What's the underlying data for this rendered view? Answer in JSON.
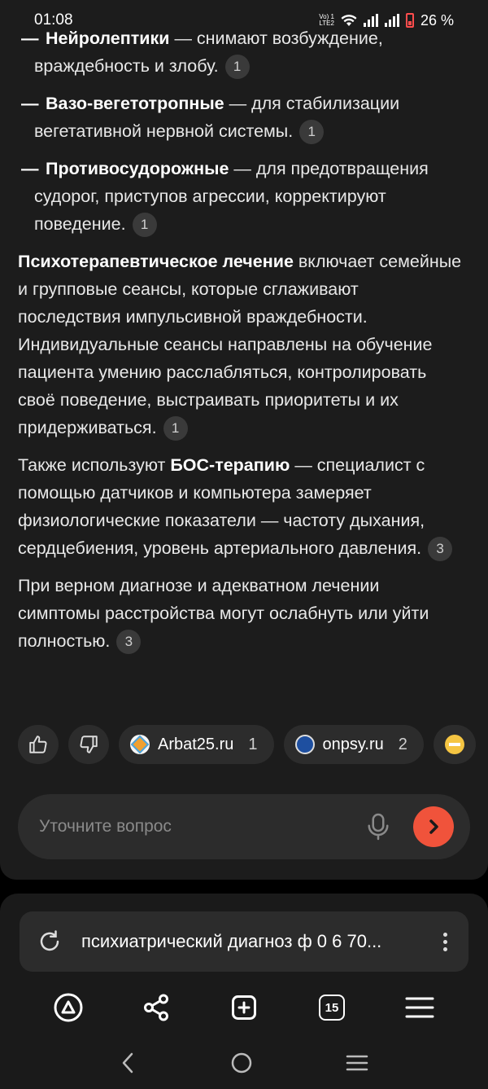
{
  "status_bar": {
    "time": "01:08",
    "network_label_top": "Vo) 1",
    "network_label_bottom": "LTE2",
    "battery": "26 %"
  },
  "answer": {
    "bullets": [
      {
        "term": "Нейролептики",
        "text": " — снимают возбуждение, враждебность и злобу.",
        "ref": "1"
      },
      {
        "term": "Вазо-вегетотропные",
        "text": " — для стабилизации вегетативной нервной системы.",
        "ref": "1"
      },
      {
        "term": "Противосудорожные",
        "text": " — для предотвращения судорог, приступов агрессии, корректируют поведение.",
        "ref": "1"
      }
    ],
    "para1": {
      "term": "Психотерапевтическое лечение",
      "text": " включает семейные и групповые сеансы, которые сглаживают последствия импульсивной враждебности. Индивидуальные сеансы направлены на обучение пациента умению расслабляться, контролировать своё поведение, выстраивать приоритеты и их придерживаться.",
      "ref": "1"
    },
    "para2": {
      "prefix": "Также используют ",
      "term": "БОС-терапию",
      "text": " — специалист с помощью датчиков и компьютера замеряет физиологические показатели — частоту дыхания, сердцебиения, уровень артериального давления.",
      "ref": "3"
    },
    "para3": {
      "text": "При верном диагнозе и адекватном лечении симптомы расстройства могут ослабнуть или уйти полностью.",
      "ref": "3"
    }
  },
  "sources": [
    {
      "name": "Arbat25.ru",
      "num": "1",
      "color": "#f0a030"
    },
    {
      "name": "onpsy.ru",
      "num": "2",
      "color": "#2d5fb0"
    }
  ],
  "ask": {
    "placeholder": "Уточните вопрос"
  },
  "url_bar": {
    "text": "психиатрический диагноз ф 0 6 70..."
  },
  "toolbar": {
    "tabs_count": "15"
  },
  "colors": {
    "accent": "#f0533b",
    "card_bg": "#1c1c1c",
    "chip_bg": "#2c2c2c"
  }
}
